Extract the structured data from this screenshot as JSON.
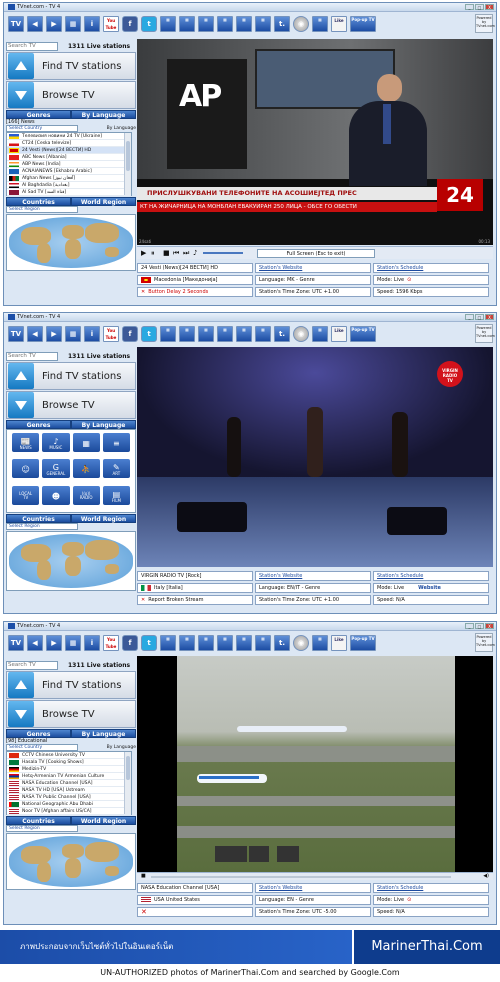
{
  "app": {
    "title": "TVnet.com - TV 4",
    "pw_text": "Powered by TVnet.com",
    "win_btns": [
      "_",
      "□",
      "X"
    ],
    "toolbar": [
      "TV",
      "◀",
      "▶",
      "▦",
      "i",
      "You Tube",
      "f",
      "t",
      "▦",
      "▦",
      "▦",
      "▦",
      "▦",
      "▦",
      "t.",
      "◉",
      "▦",
      "Like",
      "Pop-up TV"
    ]
  },
  "search": {
    "placeholder": "Search TV",
    "live": "1311 Live stations"
  },
  "buttons": {
    "find": "Find TV stations",
    "browse": "Browse TV"
  },
  "tabs": {
    "genres": "Genres",
    "lang": "By Language",
    "countries": "Countries",
    "region": "World Region"
  },
  "select_region": "Select Region",
  "w1": {
    "cat": "[166] News",
    "sel_country": "Select Country",
    "by_lang": "By Language",
    "list": [
      "Телевизия новини 24 TV [Ukraine]",
      "CT24 [Ceska televize]",
      "24 Vesti (News)[24 ВЕСТИ] HD",
      "ABC News [Albania]",
      "ABP News [India]",
      "ACNAIANEWS [Ekhabru Arabic]",
      "Afghan News [آفغان نیوز]",
      "Al Baghdadia [بغدادية]",
      "Al Sad TV [قناة السد]"
    ],
    "video": {
      "logo": "AP",
      "ticker1": "ПРИСЛУШКУВАНИ ТЕЛЕФОНИТЕ НА АСОШИЕЈТЕД ПРЕС",
      "ticker2": "КТ НА ЖИЧАРНИЦА НА МОНБЛАН ЕВАКУИРАН 250 ЛИЦА - ОБСЕ ГО ОБЕСТИ",
      "ch": "24",
      "time_l": "24sati",
      "time_r": "00:13"
    },
    "fullscreen": "Full Screen (Esc to exit)",
    "info": {
      "station": "24 Vesti (News)[24 ВЕСТИ] HD",
      "website": "Station's Website",
      "schedule": "Station's Schedule",
      "country": "Macedonia [Македонија]",
      "language": "Language: MK - Genre",
      "mode": "Mode: Live",
      "delay": "Button Delay 2 Seconds",
      "tz": "Station's Time Zone: UTC +1.00",
      "speed": "Speed: 1596 Kbps"
    }
  },
  "w2": {
    "genres": [
      [
        "📰",
        "NEWS"
      ],
      [
        "♪",
        "MUSIC"
      ],
      [
        "▦",
        ""
      ],
      [
        "≡",
        ""
      ],
      [
        "☺",
        ""
      ],
      [
        "G",
        "GENERAL"
      ],
      [
        "⛹",
        ""
      ],
      [
        "✎",
        "ART"
      ],
      [
        "LOCAL",
        "TV"
      ],
      [
        "☻",
        ""
      ],
      [
        "((o))",
        "RADIO"
      ],
      [
        "▤",
        "FILM"
      ]
    ],
    "video": {
      "badge": "VIRGIN RADIO",
      "tv": "TV"
    },
    "info": {
      "station": "VIRGIN RADIO TV [Rock]",
      "website": "Station's Website",
      "schedule": "Station's Schedule",
      "country": "Italy [Italia]",
      "language": "Language: EN/IT - Genre",
      "mode": "Mode: Live",
      "mode_link": "Website",
      "report": "Report Broken Stream",
      "tz": "Station's Time Zone: UTC +1.00",
      "speed": "Speed: N/A"
    }
  },
  "w3": {
    "cat": "[98] Educational",
    "sel_country": "Select Country",
    "by_lang": "By Language",
    "list": [
      "CCTV Chinese University TV",
      "Hasala TV [Cooking Shows]",
      "Medizin-TV",
      "Hetq-Armenian TV Armenian Culture",
      "NASA Education Channel [USA]",
      "NASA TV HD [USA] Ustream",
      "NASA TV Public Channel [USA]",
      "National Geographic Abu Dhabi",
      "Noor TV [Afghan affairs US/CA]"
    ],
    "info": {
      "station": "NASA Education Channel [USA]",
      "website": "Station's Website",
      "schedule": "Station's Schedule",
      "country": "USA United States",
      "language": "Language: EN - Genre",
      "mode": "Mode: Live",
      "tz": "Station's Time Zone: UTC -5.00",
      "speed": "Speed: N/A"
    }
  },
  "banner": {
    "thai": "ภาพประกอบจากเว็บไซต์ทั่วไปในอินเตอร์เน็ต",
    "brand": "MarinerThai.Com"
  },
  "footer": "UN-AUTHORIZED photos of MarinerThai.Com and searched by Google.Com"
}
